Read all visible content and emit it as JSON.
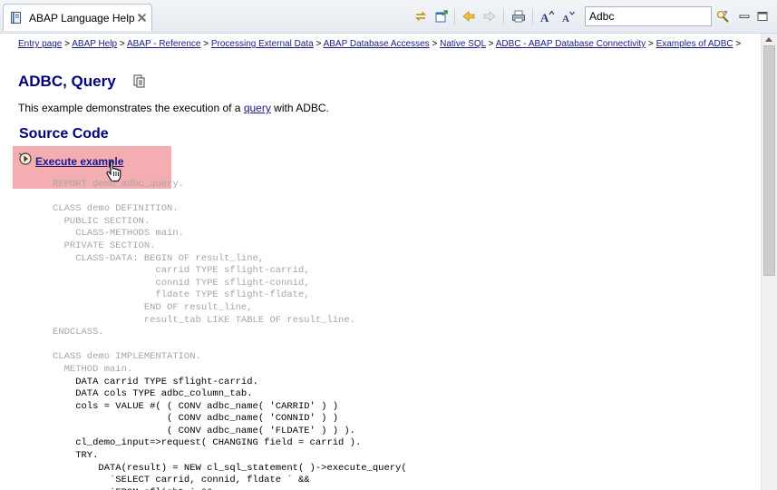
{
  "tab": {
    "title": "ABAP Language Help"
  },
  "toolbar": {
    "search_value": "Adbc",
    "buttons": [
      "sync-icon",
      "open-in-new-window-icon",
      "back-icon",
      "forward-icon",
      "print-icon",
      "increase-font-icon",
      "decrease-font-icon",
      "search-options-icon",
      "minimize-icon",
      "maximize-icon"
    ]
  },
  "breadcrumb": {
    "items": [
      "Entry page",
      "ABAP Help",
      "ABAP - Reference",
      "Processing External Data",
      "ABAP Database Accesses",
      "Native SQL",
      "ADBC - ABAP Database Connectivity",
      "Examples of ADBC"
    ],
    "separator": ">"
  },
  "page": {
    "title": "ADBC, Query",
    "intro_before": "This example demonstrates the execution of a ",
    "intro_link": "query",
    "intro_after": " with ADBC.",
    "section_title": "Source Code",
    "execute_label": "Execute example"
  },
  "code_lines": [
    {
      "text": "REPORT demo_adbc_query.",
      "style": "dim"
    },
    {
      "text": "",
      "style": "dim"
    },
    {
      "text": "CLASS demo DEFINITION.",
      "style": "dim"
    },
    {
      "text": "  PUBLIC SECTION.",
      "style": "dim"
    },
    {
      "text": "    CLASS-METHODS main.",
      "style": "dim"
    },
    {
      "text": "  PRIVATE SECTION.",
      "style": "dim"
    },
    {
      "text": "    CLASS-DATA: BEGIN OF result_line,",
      "style": "dim"
    },
    {
      "text": "                  carrid TYPE sflight-carrid,",
      "style": "dim"
    },
    {
      "text": "                  connid TYPE sflight-connid,",
      "style": "dim"
    },
    {
      "text": "                  fldate TYPE sflight-fldate,",
      "style": "dim"
    },
    {
      "text": "                END OF result_line,",
      "style": "dim"
    },
    {
      "text": "                result_tab LIKE TABLE OF result_line.",
      "style": "dim"
    },
    {
      "text": "ENDCLASS.",
      "style": "dim"
    },
    {
      "text": "",
      "style": "dim"
    },
    {
      "text": "CLASS demo IMPLEMENTATION.",
      "style": "dim"
    },
    {
      "text": "  METHOD main.",
      "style": "dim"
    },
    {
      "text": "    DATA carrid TYPE sflight-carrid.",
      "style": "dark"
    },
    {
      "text": "    DATA cols TYPE adbc_column_tab.",
      "style": "dark"
    },
    {
      "text": "    cols = VALUE #( ( CONV adbc_name( 'CARRID' ) )",
      "style": "dark"
    },
    {
      "text": "                    ( CONV adbc_name( 'CONNID' ) )",
      "style": "dark"
    },
    {
      "text": "                    ( CONV adbc_name( 'FLDATE' ) ) ).",
      "style": "dark"
    },
    {
      "text": "    cl_demo_input=>request( CHANGING field = carrid ).",
      "style": "dark"
    },
    {
      "text": "    TRY.",
      "style": "dark"
    },
    {
      "text": "        DATA(result) = NEW cl_sql_statement( )->execute_query(",
      "style": "dark"
    },
    {
      "text": "          `SELECT carrid, connid, fldate ` &&",
      "style": "dark"
    },
    {
      "text": "          `FROM sflight ` &&",
      "style": "dark"
    }
  ],
  "colors": {
    "heading": "#000080",
    "link": "#1a1a8c",
    "highlight": "#f4aeb2",
    "code_dim": "#a6a6a6"
  }
}
